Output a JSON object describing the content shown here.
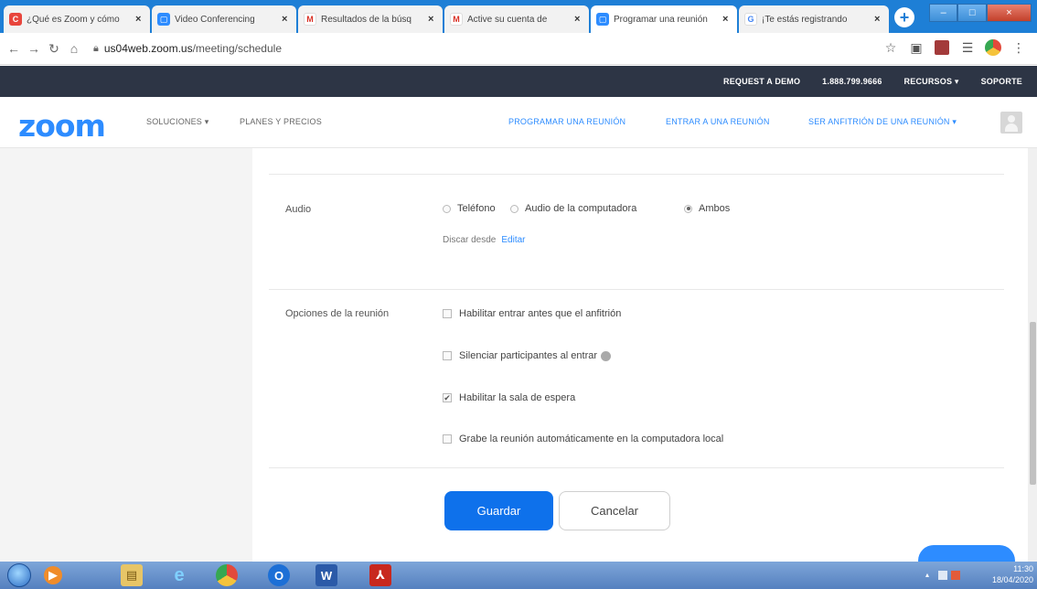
{
  "browser": {
    "tabs": [
      {
        "label": "¿Qué es Zoom y cómo",
        "close": "×",
        "icon": "chrome-icon",
        "color": "#e8453c"
      },
      {
        "label": "Video Conferencing",
        "close": "×",
        "icon": "zoom-icon",
        "color": "#2d8cff"
      },
      {
        "label": "Resultados de la búsq",
        "close": "×",
        "icon": "gmail-icon",
        "color": "#d93025"
      },
      {
        "label": "Active su cuenta de",
        "close": "×",
        "icon": "gmail-icon",
        "color": "#d93025"
      },
      {
        "label": "Programar una reunión",
        "close": "×",
        "icon": "zoom-icon",
        "color": "#2d8cff"
      },
      {
        "label": "¡Te estás registrando",
        "close": "×",
        "icon": "google-icon",
        "color": "#4285f4"
      }
    ],
    "new_tab": "+",
    "url_host": "us04web.zoom.us",
    "url_path": "/meeting/schedule"
  },
  "topbar": {
    "request_demo": "REQUEST A DEMO",
    "phone": "1.888.799.9666",
    "resources": "RECURSOS ▾",
    "support": "SOPORTE"
  },
  "nav": {
    "logo": "zoom",
    "solutions": "SOLUCIONES ▾",
    "plans": "PLANES Y PRECIOS",
    "schedule": "PROGRAMAR UNA REUNIÓN",
    "join": "ENTRAR A UNA REUNIÓN",
    "host": "SER ANFITRIÓN DE UNA REUNIÓN ▾"
  },
  "audio": {
    "label": "Audio",
    "options": [
      {
        "label": "Teléfono",
        "selected": false
      },
      {
        "label": "Audio de la computadora",
        "selected": false
      },
      {
        "label": "Ambos",
        "selected": true
      }
    ],
    "dial_from": "Discar desde",
    "edit": "Editar"
  },
  "meeting_options": {
    "label": "Opciones de la reunión",
    "items": [
      {
        "label": "Habilitar entrar antes que el anfitrión",
        "checked": false
      },
      {
        "label": "Silenciar participantes al entrar",
        "checked": false
      },
      {
        "label": "Habilitar la sala de espera",
        "checked": true
      },
      {
        "label": "Grabe la reunión automáticamente en la computadora local",
        "checked": false
      }
    ]
  },
  "actions": {
    "save": "Guardar",
    "cancel": "Cancelar"
  },
  "taskbar": {
    "time": "11:30",
    "date": "18/04/2020"
  }
}
